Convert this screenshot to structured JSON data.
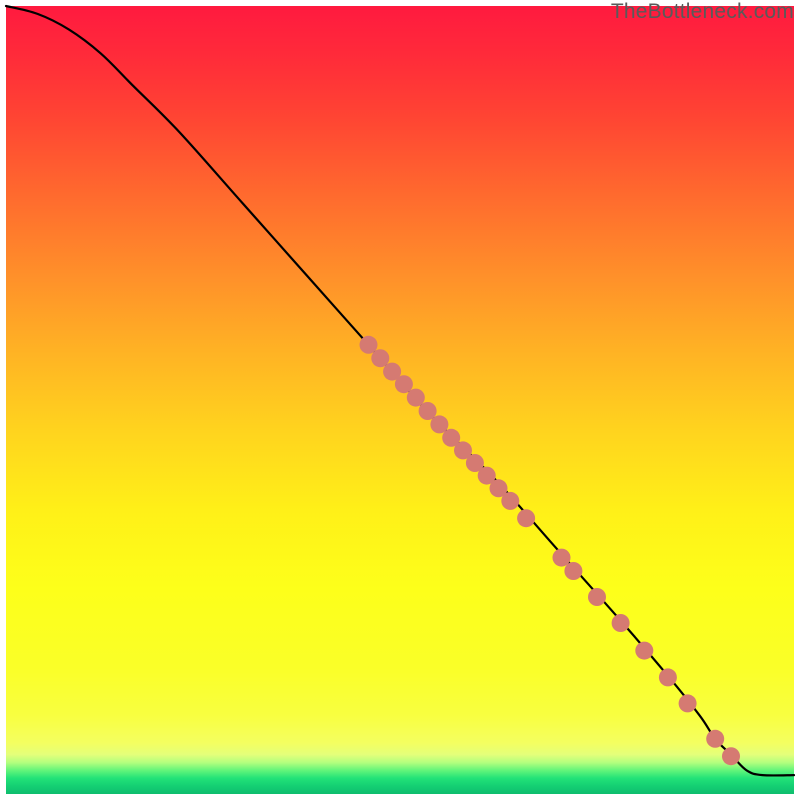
{
  "watermark": "TheBottleneck.com",
  "colors": {
    "curve": "#000000",
    "dot_fill": "#d57a72",
    "dot_stroke": "#c96a62"
  },
  "chart_data": {
    "type": "line",
    "title": "",
    "xlabel": "",
    "ylabel": "",
    "xlim": [
      0,
      100
    ],
    "ylim": [
      0,
      100
    ],
    "grid": false,
    "legend": false,
    "series": [
      {
        "name": "curve",
        "x": [
          0,
          4,
          8,
          12,
          16,
          22,
          30,
          38,
          46,
          54,
          62,
          70,
          78,
          84,
          88,
          90,
          92,
          94,
          96,
          100
        ],
        "y": [
          100,
          99,
          97,
          94,
          90,
          84,
          75,
          66,
          57,
          48,
          40,
          31,
          22,
          15,
          10,
          7,
          5,
          3,
          2.4,
          2.4
        ]
      }
    ],
    "scatter": [
      {
        "x": 46.0,
        "y": 57.0
      },
      {
        "x": 47.5,
        "y": 55.3
      },
      {
        "x": 49.0,
        "y": 53.6
      },
      {
        "x": 50.5,
        "y": 52.0
      },
      {
        "x": 52.0,
        "y": 50.3
      },
      {
        "x": 53.5,
        "y": 48.6
      },
      {
        "x": 55.0,
        "y": 46.9
      },
      {
        "x": 56.5,
        "y": 45.2
      },
      {
        "x": 58.0,
        "y": 43.6
      },
      {
        "x": 59.5,
        "y": 42.0
      },
      {
        "x": 61.0,
        "y": 40.4
      },
      {
        "x": 62.5,
        "y": 38.8
      },
      {
        "x": 64.0,
        "y": 37.2
      },
      {
        "x": 66.0,
        "y": 35.0
      },
      {
        "x": 70.5,
        "y": 30.0
      },
      {
        "x": 72.0,
        "y": 28.3
      },
      {
        "x": 75.0,
        "y": 25.0
      },
      {
        "x": 78.0,
        "y": 21.7
      },
      {
        "x": 81.0,
        "y": 18.2
      },
      {
        "x": 84.0,
        "y": 14.8
      },
      {
        "x": 86.5,
        "y": 11.5
      },
      {
        "x": 90.0,
        "y": 7.0
      },
      {
        "x": 92.0,
        "y": 4.8
      }
    ],
    "dot_radius": 9
  }
}
